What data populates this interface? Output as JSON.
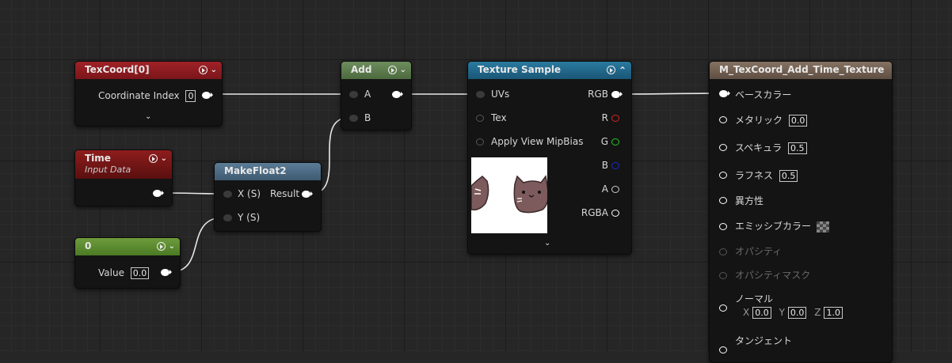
{
  "colors": {
    "texcoord_header": "#8c1c20",
    "time_header": "#7a1818",
    "add_header": "#5e7a4e",
    "makefloat_header": "#4a6a86",
    "constant_header": "#5d8a32",
    "texsample_header": "#236a8c",
    "result_header": "#756456",
    "wire": "#e8e8e8"
  },
  "nodes": {
    "texcoord": {
      "title": "TexCoord[0]",
      "pin_label": "Coordinate Index",
      "value": "0"
    },
    "time": {
      "title": "Time",
      "subtitle": "Input Data"
    },
    "constant": {
      "title": "0",
      "pin_label": "Value",
      "value": "0.0"
    },
    "makefloat2": {
      "title": "MakeFloat2",
      "in_x": "X (S)",
      "in_y": "Y (S)",
      "out": "Result"
    },
    "add": {
      "title": "Add",
      "in_a": "A",
      "in_b": "B"
    },
    "texture_sample": {
      "title": "Texture Sample",
      "inputs": [
        "UVs",
        "Tex",
        "Apply View MipBias"
      ],
      "outputs": [
        "RGB",
        "R",
        "G",
        "B",
        "A",
        "RGBA"
      ]
    },
    "material": {
      "title": "M_TexCoord_Add_Time_Texture",
      "base_color": "ベースカラー",
      "metallic": "メタリック",
      "metallic_value": "0.0",
      "specular": "スペキュラ",
      "specular_value": "0.5",
      "roughness": "ラフネス",
      "roughness_value": "0.5",
      "anisotropy": "異方性",
      "emissive": "エミッシブカラー",
      "opacity": "オパシティ",
      "opacity_mask": "オパシティマスク",
      "normal": "ノーマル",
      "normal_x_label": "X",
      "normal_x": "0.0",
      "normal_y_label": "Y",
      "normal_y": "0.0",
      "normal_z_label": "Z",
      "normal_z": "1.0",
      "tangent": "タンジェント"
    }
  }
}
